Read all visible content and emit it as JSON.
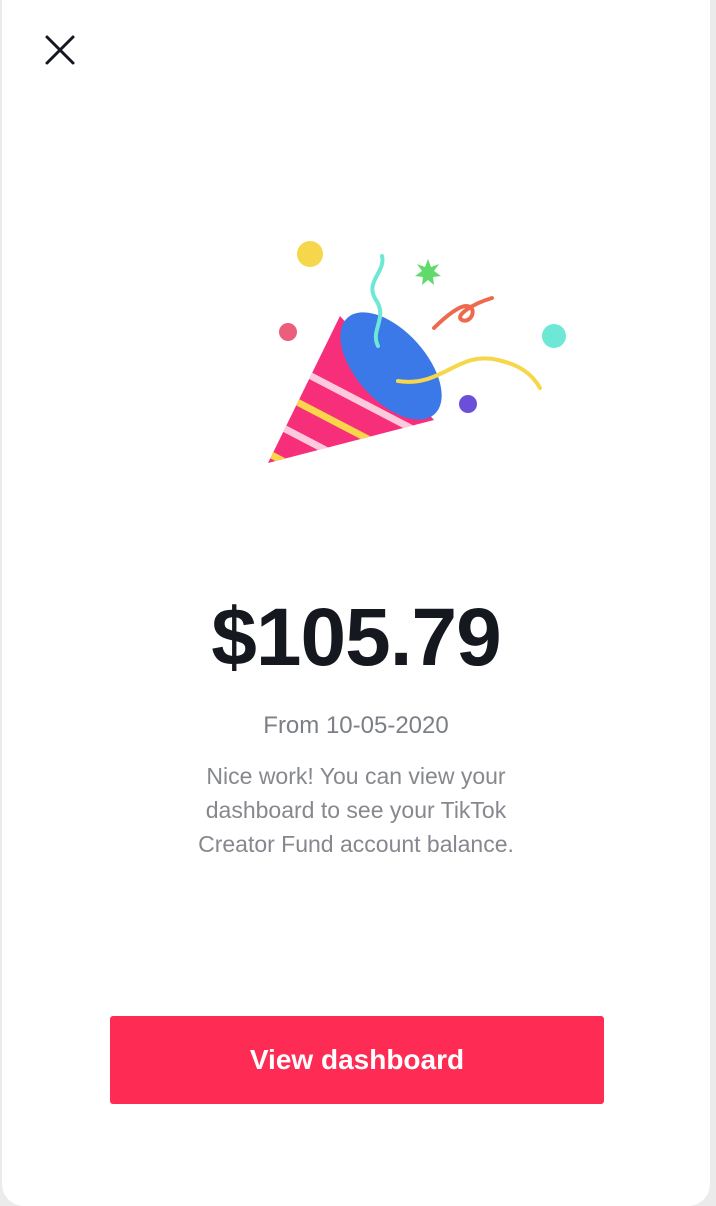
{
  "header": {
    "close_icon": "close-icon"
  },
  "illustration": {
    "icon": "party-popper-icon"
  },
  "earnings": {
    "amount": "$105.79",
    "from_date": "From 10-05-2020",
    "message": "Nice work! You can view your dashboard to see your TikTok Creator Fund account balance."
  },
  "actions": {
    "view_dashboard_label": "View dashboard"
  },
  "colors": {
    "accent": "#fe2c55",
    "amount_text": "#16181f",
    "secondary_text": "#86888e",
    "background": "#ffffff"
  }
}
